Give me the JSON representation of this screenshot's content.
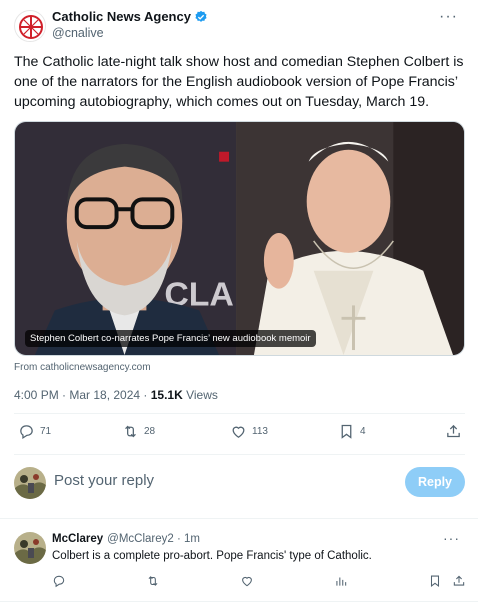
{
  "tweet": {
    "author_name": "Catholic News Agency",
    "author_handle": "@cnalive",
    "text": "The Catholic late-night talk show host and comedian Stephen Colbert is one of the narrators for the English audiobook version of Pope Francis’ upcoming autobiography, which comes out on Tuesday, March 19.",
    "media_caption": "Stephen Colbert co-narrates Pope Francis’ new audiobook memoir",
    "source": "From catholicnewsagency.com",
    "timestamp": "4:00 PM · Mar 18, 2024 · ",
    "views_count": "15.1K",
    "views_label": " Views",
    "stats": {
      "replies": "71",
      "reposts": "28",
      "likes": "113",
      "bookmarks": "4"
    }
  },
  "reply_box": {
    "placeholder": "Post your reply",
    "button_label": "Reply"
  },
  "comment": {
    "name": "McClarey",
    "handle": "@McClarey2 · 1m",
    "text": "Colbert is a complete pro-abort.  Pope Francis' type of Catholic."
  },
  "colors": {
    "accent": "#1d9bf0",
    "reply_button_disabled": "#8ecdf7",
    "muted_text": "#536471",
    "brand_red": "#d0202a"
  },
  "icons": {
    "more": "more-horizontal-icon",
    "verified": "verified-badge-icon",
    "reply": "reply-icon",
    "repost": "repost-icon",
    "like": "heart-icon",
    "bookmark": "bookmark-icon",
    "share": "share-icon",
    "views": "views-icon"
  }
}
